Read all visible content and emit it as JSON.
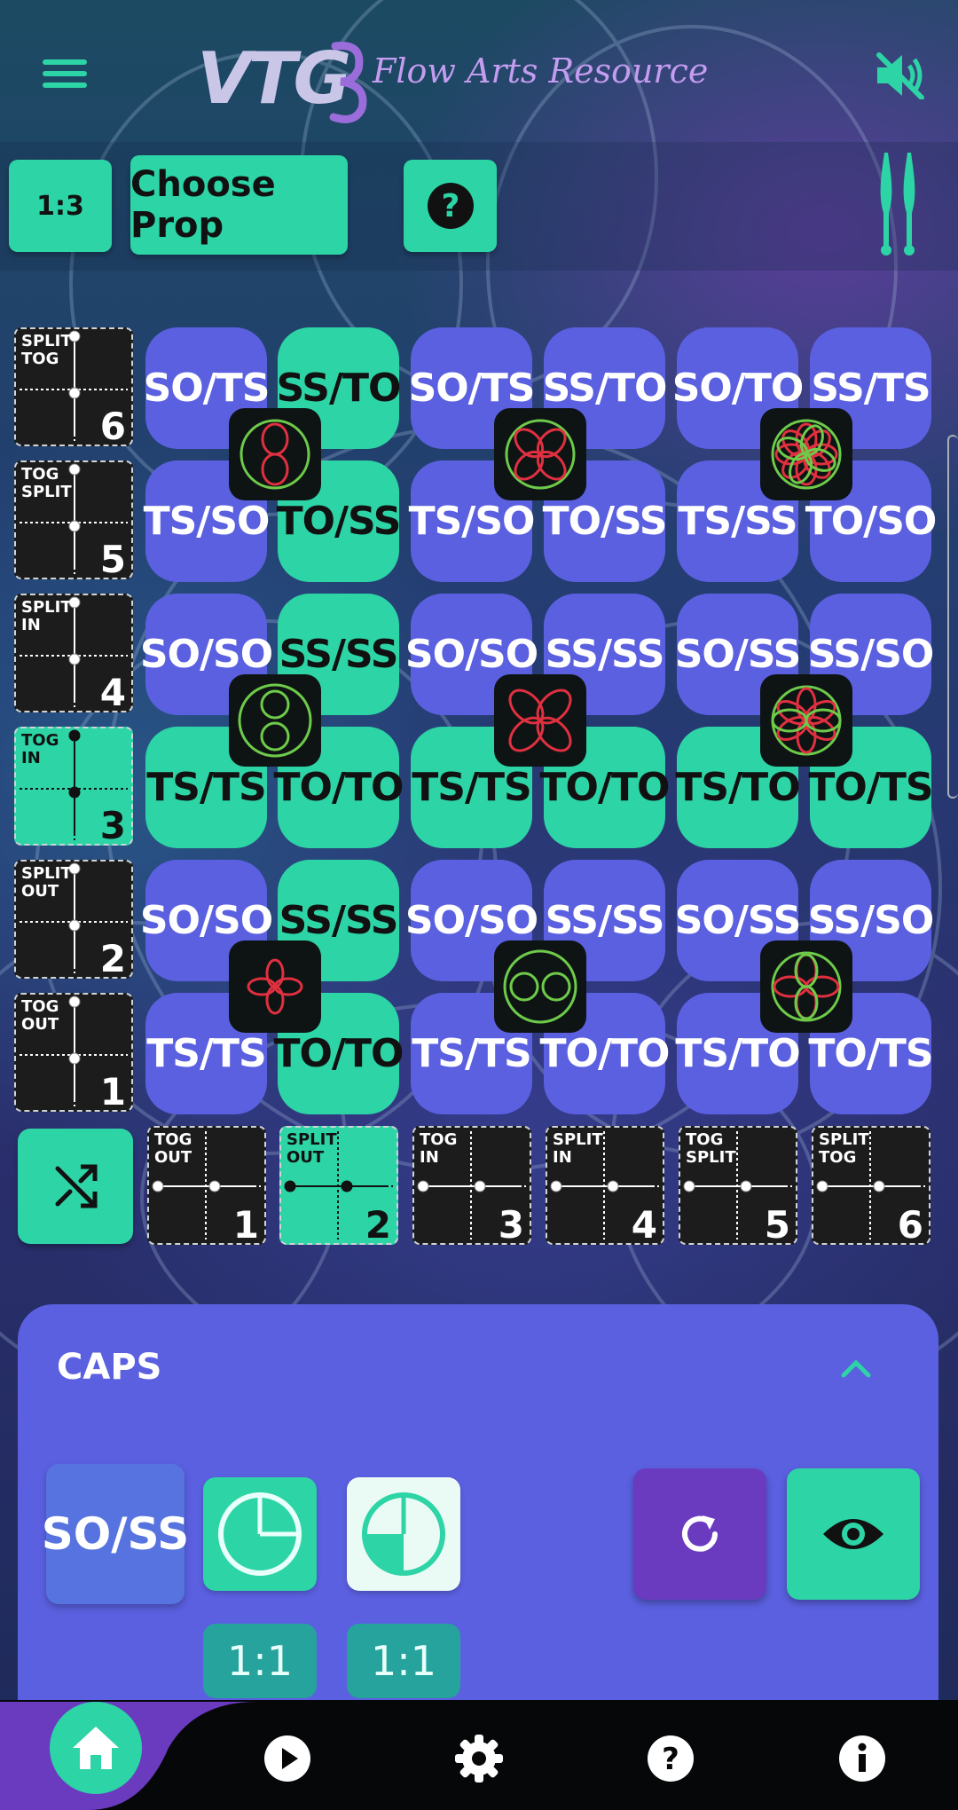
{
  "header": {
    "logo_text": "VTG",
    "logo_sub": "Flow Arts Resource",
    "icons": [
      "menu-icon",
      "volume-mute-icon"
    ]
  },
  "toolbar": {
    "ratio_label": "1:3",
    "choose_prop_label": "Choose Prop",
    "help_icon": "question-icon",
    "prop_icon": "juggling-clubs-icon"
  },
  "grid": {
    "rows": [
      {
        "cells": [
          {
            "label": "SO/TS",
            "color": "blue"
          },
          {
            "label": "SS/TO",
            "color": "teal"
          },
          {
            "label": "SO/TS",
            "color": "blue"
          },
          {
            "label": "SS/TO",
            "color": "blue"
          },
          {
            "label": "SO/TO",
            "color": "blue"
          },
          {
            "label": "SS/TS",
            "color": "blue"
          }
        ]
      },
      {
        "cells": [
          {
            "label": "TS/SO",
            "color": "blue"
          },
          {
            "label": "TO/SS",
            "color": "teal"
          },
          {
            "label": "TS/SO",
            "color": "blue"
          },
          {
            "label": "TO/SS",
            "color": "blue"
          },
          {
            "label": "TS/SS",
            "color": "blue"
          },
          {
            "label": "TO/SO",
            "color": "blue"
          }
        ]
      },
      {
        "cells": [
          {
            "label": "SO/SO",
            "color": "blue"
          },
          {
            "label": "SS/SS",
            "color": "teal"
          },
          {
            "label": "SO/SO",
            "color": "blue"
          },
          {
            "label": "SS/SS",
            "color": "blue"
          },
          {
            "label": "SO/SS",
            "color": "blue"
          },
          {
            "label": "SS/SO",
            "color": "blue"
          }
        ]
      },
      {
        "cells": [
          {
            "label": "TS/TS",
            "color": "teal"
          },
          {
            "label": "TO/TO",
            "color": "teal"
          },
          {
            "label": "TS/TS",
            "color": "teal"
          },
          {
            "label": "TO/TO",
            "color": "teal"
          },
          {
            "label": "TS/TO",
            "color": "teal"
          },
          {
            "label": "TO/TS",
            "color": "teal"
          }
        ]
      },
      {
        "cells": [
          {
            "label": "SO/SO",
            "color": "blue"
          },
          {
            "label": "SS/SS",
            "color": "teal"
          },
          {
            "label": "SO/SO",
            "color": "blue"
          },
          {
            "label": "SS/SS",
            "color": "blue"
          },
          {
            "label": "SO/SS",
            "color": "blue"
          },
          {
            "label": "SS/SO",
            "color": "blue"
          }
        ]
      },
      {
        "cells": [
          {
            "label": "TS/TS",
            "color": "blue"
          },
          {
            "label": "TO/TO",
            "color": "teal"
          },
          {
            "label": "TS/TS",
            "color": "blue"
          },
          {
            "label": "TO/TO",
            "color": "blue"
          },
          {
            "label": "TS/TO",
            "color": "blue"
          },
          {
            "label": "TO/TS",
            "color": "blue"
          }
        ]
      }
    ],
    "flowers": [
      [
        "two-petal-flower-icon",
        "four-petal-flower-icon",
        "eight-petal-flower-icon"
      ],
      [
        "circle-pair-icon",
        "four-petal-red-icon",
        "six-petal-flower-icon"
      ],
      [
        "small-four-petal-icon",
        "circle-pair-horizontal-icon",
        "four-petal-green-icon"
      ]
    ]
  },
  "side_timings": [
    {
      "line1": "SPLIT",
      "line2": "TOG",
      "number": "6",
      "active": false
    },
    {
      "line1": "TOG",
      "line2": "SPLIT",
      "number": "5",
      "active": false
    },
    {
      "line1": "SPLIT",
      "line2": "IN",
      "number": "4",
      "active": false
    },
    {
      "line1": "TOG",
      "line2": "IN",
      "number": "3",
      "active": true
    },
    {
      "line1": "SPLIT",
      "line2": "OUT",
      "number": "2",
      "active": false
    },
    {
      "line1": "TOG",
      "line2": "OUT",
      "number": "1",
      "active": false
    }
  ],
  "bottom_timings": [
    {
      "line1": "TOG",
      "line2": "OUT",
      "number": "1",
      "active": false
    },
    {
      "line1": "SPLIT",
      "line2": "OUT",
      "number": "2",
      "active": true
    },
    {
      "line1": "TOG",
      "line2": "IN",
      "number": "3",
      "active": false
    },
    {
      "line1": "SPLIT",
      "line2": "IN",
      "number": "4",
      "active": false
    },
    {
      "line1": "TOG",
      "line2": "SPLIT",
      "number": "5",
      "active": false
    },
    {
      "line1": "SPLIT",
      "line2": "TOG",
      "number": "6",
      "active": false
    }
  ],
  "caps": {
    "title": "CAPS",
    "selected_label": "SO/SS",
    "ratio_left": "1:1",
    "ratio_right": "1:1",
    "pie_left_fraction": 0.75,
    "pie_right_fraction": 0.25
  },
  "colors": {
    "teal": "#2dd4a6",
    "blue": "#5b60e0",
    "purple": "#6a3bbf",
    "flower_red": "#e03040",
    "flower_green": "#6ecb4a"
  },
  "nav": [
    "home-icon",
    "play-icon",
    "settings-icon",
    "help-icon",
    "info-icon"
  ]
}
